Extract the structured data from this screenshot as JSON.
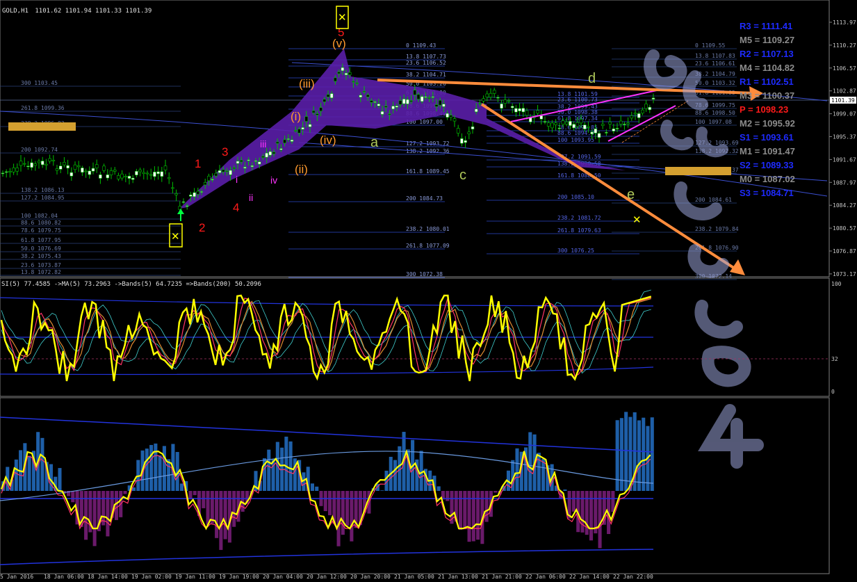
{
  "chart_header": {
    "symbol_tf": "GOLD,H1",
    "ohlc": "1101.62 1101.94 1101.33 1101.39"
  },
  "current_price": "1101.39",
  "price_axis": {
    "ticks": [
      "1113.97",
      "1110.27",
      "1106.57",
      "1102.87",
      "1099.07",
      "1095.37",
      "1091.67",
      "1087.97",
      "1084.27",
      "1080.57",
      "1076.87",
      "1073.17"
    ]
  },
  "pivots": [
    {
      "label": "R3 = 1111.41",
      "color": "#1e2bff"
    },
    {
      "label": "M5 = 1109.27",
      "color": "#8c8c8c"
    },
    {
      "label": "R2 = 1107.13",
      "color": "#1e2bff"
    },
    {
      "label": "M4 = 1104.82",
      "color": "#8c8c8c"
    },
    {
      "label": "R1 = 1102.51",
      "color": "#1e2bff"
    },
    {
      "label": "M3 = 1100.37",
      "color": "#8c8c8c"
    },
    {
      "label": "P = 1098.23",
      "color": "#ff1a1a"
    },
    {
      "label": "M2 = 1095.92",
      "color": "#8c8c8c"
    },
    {
      "label": "S1 = 1093.61",
      "color": "#1e2bff"
    },
    {
      "label": "M1 = 1091.47",
      "color": "#8c8c8c"
    },
    {
      "label": "S2 = 1089.33",
      "color": "#1e2bff"
    },
    {
      "label": "M0 = 1087.02",
      "color": "#8c8c8c"
    },
    {
      "label": "S3 = 1084.71",
      "color": "#1e2bff"
    }
  ],
  "wave_labels": {
    "impulse_red": [
      "1",
      "2",
      "3",
      "4",
      "5"
    ],
    "impulse_magenta": [
      "i",
      "ii",
      "iii",
      "iv"
    ],
    "impulse_orange": [
      "(i)",
      "(ii)",
      "(iii)",
      "(iv)",
      "(v)"
    ],
    "corrective": [
      "a",
      "c",
      "d",
      "e"
    ]
  },
  "fib_left": [
    {
      "text": "300 1103.45"
    },
    {
      "text": "261.8 1099.36"
    },
    {
      "text": "238.2 1096.83"
    },
    {
      "text": "200 1092.74"
    },
    {
      "text": "138.2 1086.13"
    },
    {
      "text": "127.2 1084.95"
    },
    {
      "text": "100 1082.04"
    },
    {
      "text": "88.6 1080.82"
    },
    {
      "text": "78.6 1079.75"
    },
    {
      "text": "61.8 1077.95"
    },
    {
      "text": "50.0 1076.69"
    },
    {
      "text": "38.2 1075.43"
    },
    {
      "text": "23.6 1073.87"
    },
    {
      "text": "13.8 1072.82"
    }
  ],
  "fib_mid": [
    {
      "text": "0 1109.43"
    },
    {
      "text": "13.8 1107.73"
    },
    {
      "text": "23.6 1106.52"
    },
    {
      "text": "38.2 1104.71"
    },
    {
      "text": "50.0 1103.26"
    },
    {
      "text": "61.8 1101.80"
    },
    {
      "text": "78.6 1099.72"
    },
    {
      "text": "88.6 1098.49"
    },
    {
      "text": "100 1097.00"
    },
    {
      "text": "127.2 1093.72"
    },
    {
      "text": "138.2 1092.36"
    },
    {
      "text": "161.8 1089.45"
    },
    {
      "text": "200 1084.73"
    },
    {
      "text": "238.2 1080.01"
    },
    {
      "text": "261.8 1077.09"
    },
    {
      "text": "300 1072.38"
    }
  ],
  "fib_right_a": [
    {
      "text": "13.8 1101.59"
    },
    {
      "text": "23.6 1100.73"
    },
    {
      "text": "38.2 1099.43"
    },
    {
      "text": "50.0 1098.38"
    },
    {
      "text": "61.8 1097.34"
    },
    {
      "text": "78.6 1095.85"
    },
    {
      "text": "88.6 1094.97"
    },
    {
      "text": "100 1093.95"
    },
    {
      "text": "127.2 1091.59"
    },
    {
      "text": "138.2 1090.58"
    },
    {
      "text": "161.8 1088.50"
    },
    {
      "text": "200 1085.10"
    },
    {
      "text": "238.2 1081.72"
    },
    {
      "text": "261.8 1079.63"
    },
    {
      "text": "300 1076.25"
    }
  ],
  "fib_right_b": [
    {
      "text": "0 1109.55"
    },
    {
      "text": "13.8 1107.83"
    },
    {
      "text": "23.6 1106.61"
    },
    {
      "text": "38.2 1104.79"
    },
    {
      "text": "50.0 1103.32"
    },
    {
      "text": "61.8 1101.85"
    },
    {
      "text": "78.6 1099.75"
    },
    {
      "text": "88.6 1098.50"
    },
    {
      "text": "100 1097.08"
    },
    {
      "text": "127.2 1093.69"
    },
    {
      "text": "138.2 1092.32"
    },
    {
      "text": "161.8 1089.37"
    },
    {
      "text": "200 1084.61"
    },
    {
      "text": "238.2 1079.84"
    },
    {
      "text": "261.8 1076.90"
    },
    {
      "text": "300 1072.14"
    }
  ],
  "rsi_header": "SI(5) 77.4585  ->MA(5) 73.2963  ->Bands(5) 64.7235  =>Bands(200) 50.2096",
  "rsi_axis": {
    "top": "100",
    "mid": "32",
    "bottom": "0"
  },
  "date_axis": [
    "5 Jan 2016",
    "18 Jan 06:00",
    "18 Jan 14:00",
    "19 Jan 02:00",
    "19 Jan 11:00",
    "19 Jan 19:00",
    "20 Jan 04:00",
    "20 Jan 12:00",
    "20 Jan 20:00",
    "21 Jan 05:00",
    "21 Jan 13:00",
    "21 Jan 21:00",
    "22 Jan 06:00",
    "22 Jan 14:00",
    "22 Jan 22:00"
  ],
  "colors": {
    "bull_candle": "#ffffff",
    "bear_candle": "#000000",
    "candle_wick": "#00ff00",
    "purple_zone": "#5a1ea8",
    "arrow": "#ff8c3c",
    "magenta_line": "#ff33ff",
    "watermark": "#9aa3d8"
  }
}
